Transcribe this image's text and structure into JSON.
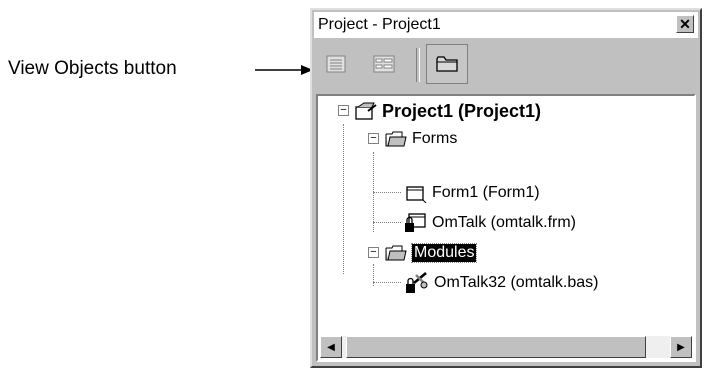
{
  "callout": {
    "text": "View Objects button"
  },
  "window": {
    "title": "Project - Project1",
    "close_symbol": "✕"
  },
  "toolbar": {
    "buttons": [
      {
        "name": "view-code",
        "icon": "view-code-icon"
      },
      {
        "name": "view-object",
        "icon": "view-object-icon"
      },
      {
        "name": "toggle-folders",
        "icon": "folder-icon"
      }
    ]
  },
  "tree": {
    "project": {
      "label": "Project1 (Project1)",
      "icon": "project-icon",
      "expander": "−"
    },
    "forms": {
      "label": "Forms",
      "icon": "open-folder-icon",
      "expander": "−"
    },
    "form1": {
      "label": "Form1 (Form1)",
      "icon": "form-icon"
    },
    "omtalk": {
      "label": "OmTalk (omtalk.frm)",
      "icon": "form-locked-icon"
    },
    "modules": {
      "label": "Modules",
      "icon": "open-folder-icon",
      "expander": "−",
      "selected": true
    },
    "omtalk32": {
      "label": "OmTalk32 (omtalk.bas)",
      "icon": "module-locked-icon"
    }
  },
  "scrollbar": {
    "left_arrow": "◀",
    "right_arrow": "▶"
  }
}
